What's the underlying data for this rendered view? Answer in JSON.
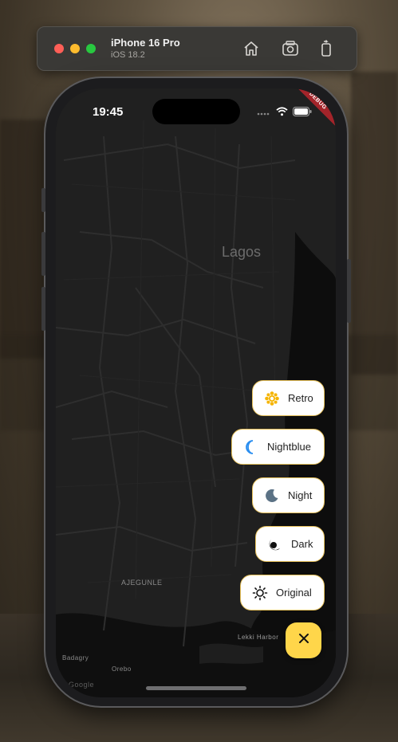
{
  "simulator": {
    "device_name": "iPhone 16 Pro",
    "os_version": "iOS 18.2",
    "icons": [
      "home-icon",
      "screenshot-icon",
      "rotate-icon"
    ]
  },
  "status_bar": {
    "time": "19:45",
    "debug_banner": "DEBUG"
  },
  "map": {
    "city_label": "Lagos",
    "area_labels": [
      "AJEGUNLE",
      "Lekki Harbor",
      "Badagry",
      "Orebo"
    ],
    "google_logo": "Google"
  },
  "map_style_menu": {
    "items": [
      {
        "label": "Retro",
        "icon": "sun-flower-icon",
        "icon_color": "#f5b400"
      },
      {
        "label": "Nightblue",
        "icon": "crescent-moon-icon",
        "icon_color": "#2a8ef0"
      },
      {
        "label": "Night",
        "icon": "moon-icon",
        "icon_color": "#5b7285"
      },
      {
        "label": "Dark",
        "icon": "dark-moon-icon",
        "icon_color": "#111111"
      },
      {
        "label": "Original",
        "icon": "sun-outline-icon",
        "icon_color": "#111111"
      }
    ],
    "close_icon": "close-icon",
    "accent_color": "#ffd64a"
  }
}
